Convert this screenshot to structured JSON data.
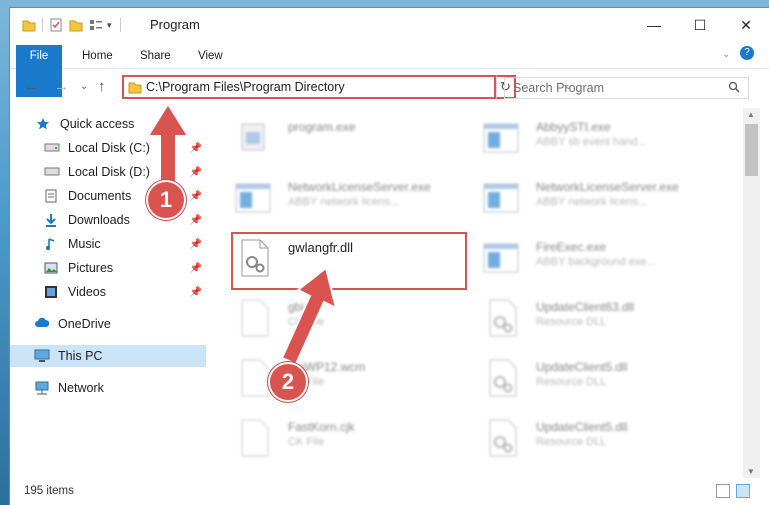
{
  "window": {
    "title": "Program",
    "minimize": "—",
    "maximize": "☐",
    "close": "✕"
  },
  "ribbon": {
    "tabs": [
      "File",
      "Home",
      "Share",
      "View"
    ],
    "help": "?"
  },
  "address": {
    "path": "C:\\Program Files\\Program Directory",
    "dropdown": "⌵",
    "refresh": "↻"
  },
  "search": {
    "placeholder": "Search Program",
    "icon": "search-icon"
  },
  "nav": {
    "items": [
      {
        "label": "Quick access",
        "icon": "star-icon",
        "pinned": false
      },
      {
        "label": "Local Disk (C:)",
        "icon": "drive-icon",
        "pinned": true
      },
      {
        "label": "Local Disk (D:)",
        "icon": "drive-icon",
        "pinned": true
      },
      {
        "label": "Documents",
        "icon": "documents-icon",
        "pinned": true
      },
      {
        "label": "Downloads",
        "icon": "downloads-icon",
        "pinned": true
      },
      {
        "label": "Music",
        "icon": "music-icon",
        "pinned": true
      },
      {
        "label": "Pictures",
        "icon": "pictures-icon",
        "pinned": true
      },
      {
        "label": "Videos",
        "icon": "videos-icon",
        "pinned": true
      },
      {
        "label": "OneDrive",
        "icon": "cloud-icon",
        "pinned": false
      },
      {
        "label": "This PC",
        "icon": "pc-icon",
        "pinned": false,
        "selected": true
      },
      {
        "label": "Network",
        "icon": "network-icon",
        "pinned": false
      }
    ]
  },
  "files": {
    "left": [
      {
        "name": "program.exe",
        "sub": ""
      },
      {
        "name": "NetworkLicenseServer.exe",
        "sub": "ABBY network licens..."
      },
      {
        "name": "gwlangfr.dll",
        "sub": ""
      },
      {
        "name": "gbi...",
        "sub": "CK File"
      },
      {
        "name": "...oWP12.wcm",
        "sub": "CK File"
      },
      {
        "name": "FastKorn.cjk",
        "sub": "CK File"
      }
    ],
    "right": [
      {
        "name": "AbbyySTI.exe",
        "sub": "ABBY sb event hand..."
      },
      {
        "name": "NetworkLicenseServer.exe",
        "sub": "ABBY network licens..."
      },
      {
        "name": "FireExec.exe",
        "sub": "ABBY background exe..."
      },
      {
        "name": "UpdateClient63.dll",
        "sub": "Resource DLL"
      },
      {
        "name": "UpdateClient5.dll",
        "sub": "Resource DLL"
      },
      {
        "name": "UpdateClient5.dll",
        "sub": "Resource DLL"
      }
    ]
  },
  "annotations": {
    "step1": "1",
    "step2": "2"
  },
  "status": {
    "count": "195 items"
  },
  "colors": {
    "accent": "#1979ca",
    "highlight": "#d9534f",
    "selected_nav": "#cce4f7"
  }
}
